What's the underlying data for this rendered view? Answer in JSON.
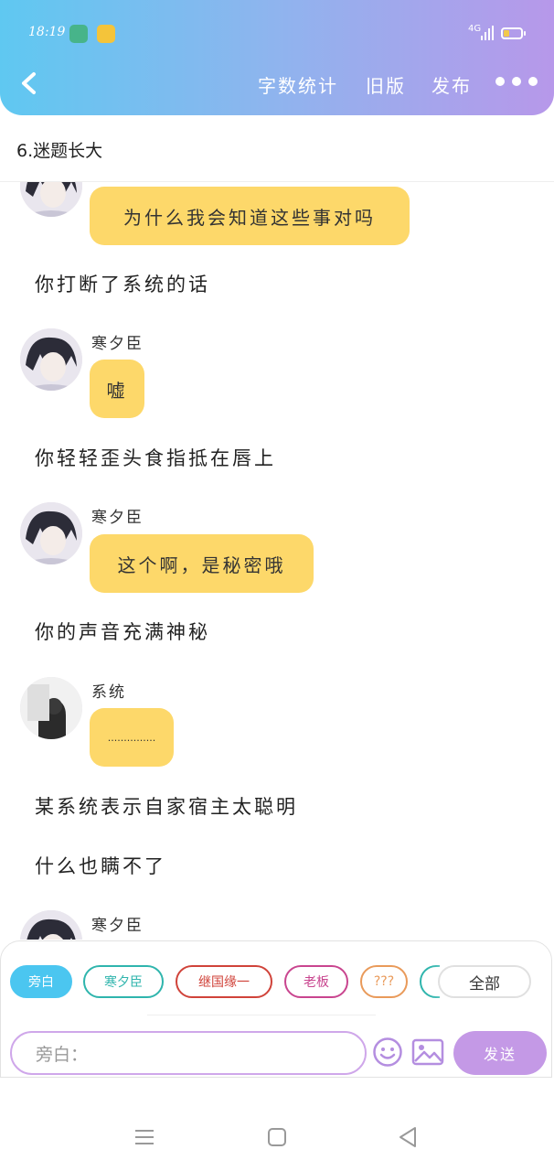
{
  "status_bar": {
    "time": "18:19",
    "network": "4G"
  },
  "header": {
    "word_count": "字数统计",
    "old_version": "旧版",
    "publish": "发布"
  },
  "chapter_title": "6.迷题长大",
  "feed": {
    "bubble_top": "为什么我会知道这些事对吗",
    "narration_1": "你打断了系统的话",
    "name_1": "寒夕臣",
    "bubble_1": "嘘",
    "narration_2": "你轻轻歪头食指抵在唇上",
    "name_2": "寒夕臣",
    "bubble_2": "这个啊，是秘密哦",
    "narration_3": "你的声音充满神秘",
    "name_3": "系统",
    "bubble_3": "...............",
    "narration_4": "某系统表示自家宿主太聪明",
    "narration_5": "什么也瞒不了",
    "name_4": "寒夕臣"
  },
  "role_tags": [
    {
      "label": "旁白",
      "color": "#4bc6f0",
      "active": true
    },
    {
      "label": "寒夕臣",
      "color": "#2fb5ad",
      "active": false
    },
    {
      "label": "继国缘一",
      "color": "#d0433a",
      "active": false
    },
    {
      "label": "老板",
      "color": "#c9458f",
      "active": false
    },
    {
      "label": "???",
      "color": "#e99a5a",
      "active": false
    }
  ],
  "all_button": "全部",
  "input": {
    "placeholder": "旁白："
  },
  "send_button": "发送",
  "icons": [
    "back-icon",
    "more-icon",
    "emoji-icon",
    "image-icon",
    "menu-icon",
    "home-icon",
    "back-triangle-icon"
  ]
}
